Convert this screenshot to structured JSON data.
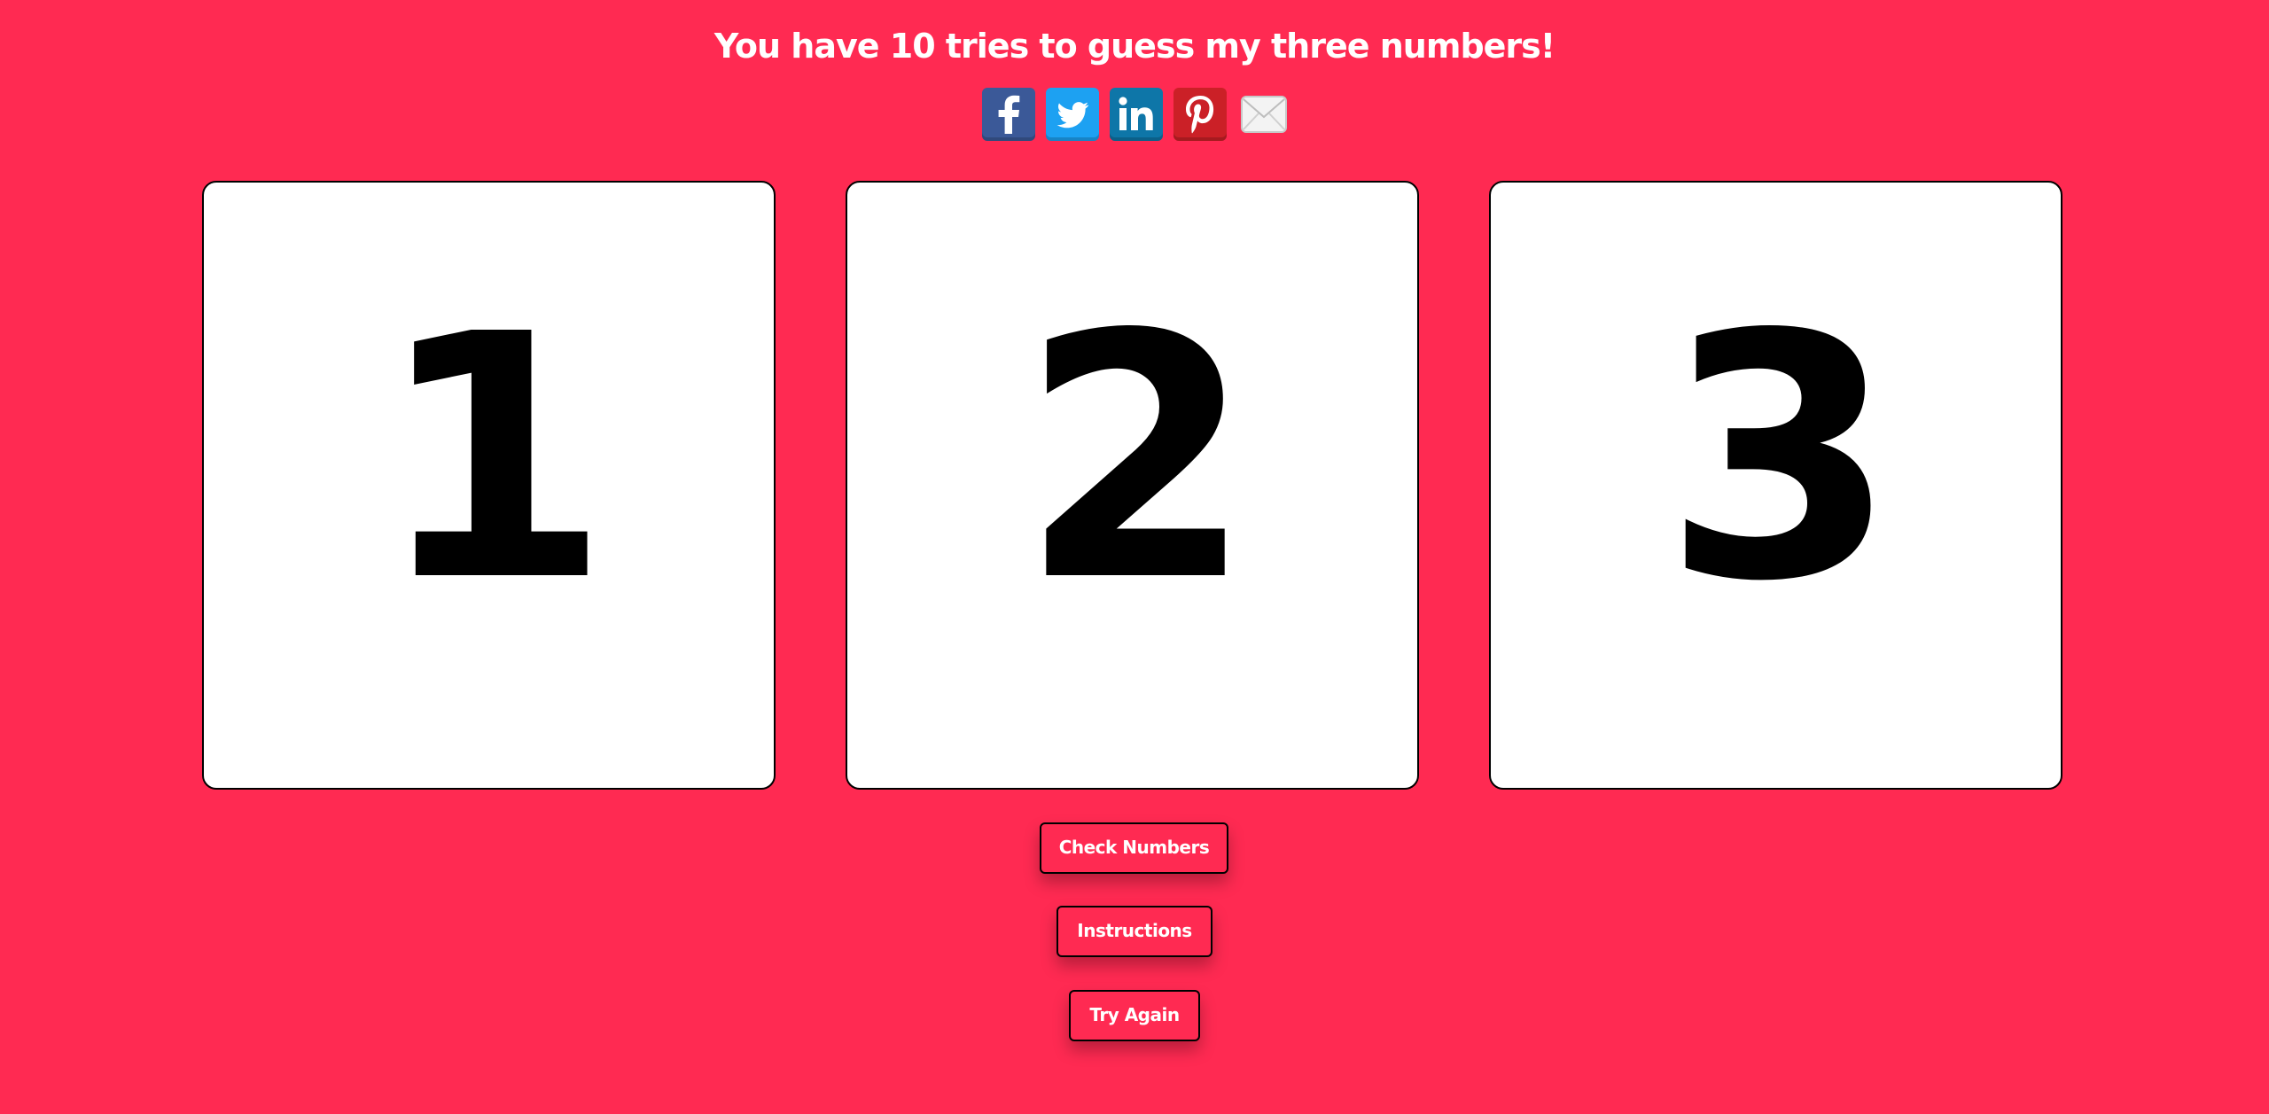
{
  "header": {
    "title": "You have 10 tries to guess my three numbers!"
  },
  "social": [
    {
      "name": "facebook",
      "icon": "facebook-icon",
      "color": "#3b5998"
    },
    {
      "name": "twitter",
      "icon": "twitter-icon",
      "color": "#1da1f2"
    },
    {
      "name": "linkedin",
      "icon": "linkedin-icon",
      "color": "#0e76a8"
    },
    {
      "name": "pinterest",
      "icon": "pinterest-icon",
      "color": "#cb2027"
    },
    {
      "name": "email",
      "icon": "email-icon",
      "color": "#e8e8e8"
    }
  ],
  "cards": [
    {
      "value": "1"
    },
    {
      "value": "2"
    },
    {
      "value": "3"
    }
  ],
  "buttons": {
    "check": "Check Numbers",
    "instructions": "Instructions",
    "try_again": "Try Again"
  },
  "theme": {
    "background": "#ff2a52",
    "card": "#ffffff",
    "text": "#ffffff"
  }
}
